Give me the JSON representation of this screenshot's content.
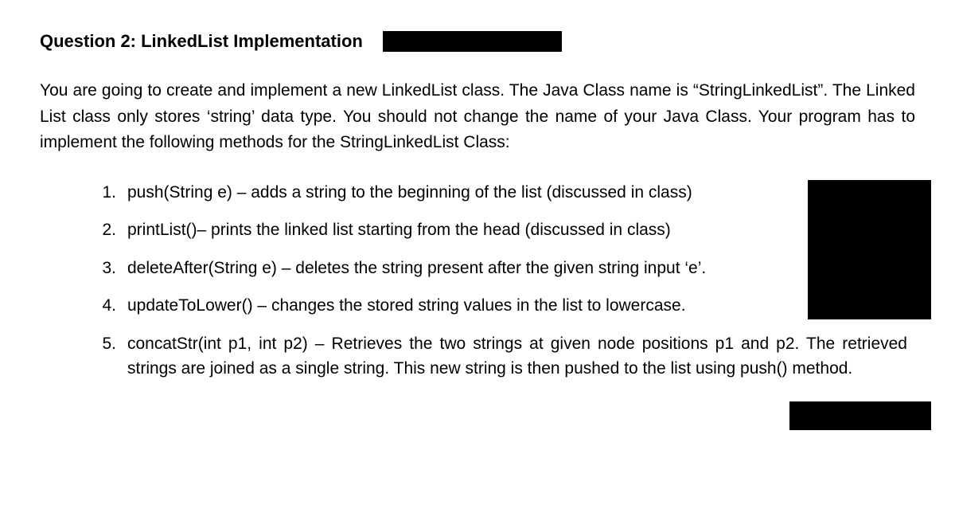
{
  "heading": "Question 2: LinkedList Implementation",
  "intro": "You are going to create and implement a new LinkedList class. The Java Class name is “StringLinkedList”. The Linked List class only stores ‘string’ data type. You should not change the name of your Java Class. Your program has to implement the following methods for the StringLinkedList Class:",
  "items": [
    {
      "num": "1.",
      "text": "push(String e) – adds a string to the beginning of the list (discussed in class)"
    },
    {
      "num": "2.",
      "text": "printList()– prints the linked list starting from the head (discussed in class)"
    },
    {
      "num": "3.",
      "text": "deleteAfter(String e) – deletes the string present after the given string input ‘e’."
    },
    {
      "num": "4.",
      "text": "updateToLower() – changes the stored string values in the list to lowercase."
    },
    {
      "num": "5.",
      "text": "concatStr(int p1, int p2) – Retrieves the two strings at given node positions p1 and p2. The retrieved strings are joined as a single string. This new string is then pushed to the list using push() method."
    }
  ]
}
